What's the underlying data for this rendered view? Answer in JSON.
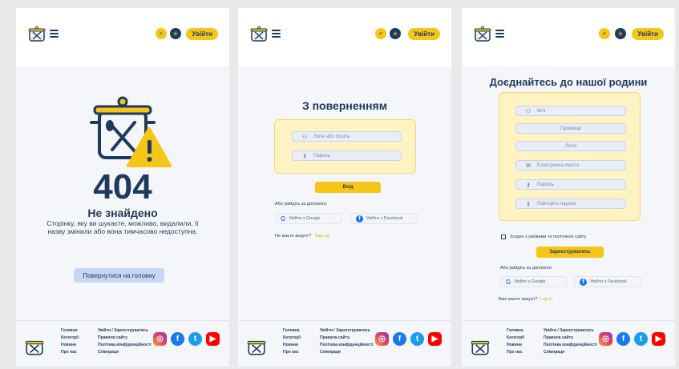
{
  "header": {
    "login_label": "Увійти"
  },
  "error_page": {
    "code": "404",
    "title": "Не знайдено",
    "message": "Сторінку, яку ви шукаєте, можливо, видалили, її назву змінили або вона тимчасово недоступна.",
    "back_button": "Повернутися на головну"
  },
  "login_page": {
    "title": "З поверненням",
    "login_placeholder": "Логін або пошта",
    "password_placeholder": "Пароль",
    "submit_label": "Вхід",
    "alt_text": "Або увійдіть за допомоги",
    "google_label": "Увійти з Google",
    "facebook_label": "Увійти з Facebook",
    "no_account": "Не маєте акаунт?",
    "signup_link": "Sign up"
  },
  "register_page": {
    "title": "Доєднайтесь до нашої родини",
    "name_placeholder": "Ім'я",
    "surname_placeholder": "Прізвище",
    "login_placeholder": "Логін",
    "email_placeholder": "Електронна пошта",
    "password_placeholder": "Пароль",
    "repeat_password_placeholder": "Повторіть пароль",
    "agree_text": "Згоден з умовами та політикою сайту",
    "submit_label": "Зареєструватись",
    "alt_text": "Або увійдіть за допомоги",
    "google_label": "Увійти з Google",
    "facebook_label": "Увійти з Facebook",
    "have_account": "Вже маєте акаунт?",
    "login_link": "Log in"
  },
  "footer": {
    "col1": [
      "Головна",
      "Категорії",
      "Новини",
      "Про нас"
    ],
    "col2": [
      "Увійти / Зареєструватись",
      "Правила сайту",
      "Політика конфіденційності",
      "Співпраця"
    ]
  },
  "icons": {
    "search": "search-icon",
    "theme": "sun-icon",
    "menu": "menu-icon",
    "instagram": "instagram-icon",
    "facebook": "facebook-icon",
    "twitter": "twitter-icon",
    "youtube": "youtube-icon"
  },
  "colors": {
    "accent": "#f5c518",
    "navy": "#1f3a5f",
    "card": "#fff3c4",
    "field": "#e8edf8"
  }
}
